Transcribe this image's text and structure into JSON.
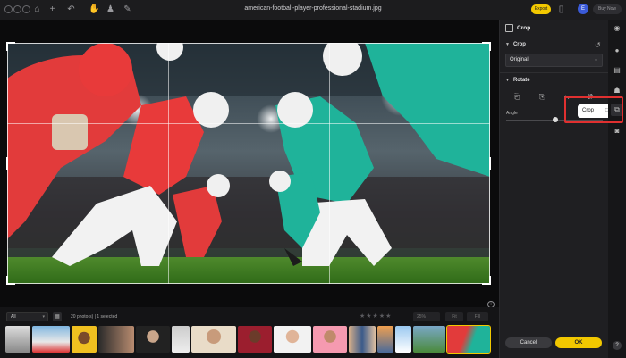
{
  "window": {
    "title": "american-football-player-professional-stadium.jpg"
  },
  "topbar": {
    "export_label": "Export",
    "user_initial": "E",
    "buy_label": "Buy Now"
  },
  "filmstrip": {
    "filter_value": "All",
    "photo_count": "20 photo(s) | 1 selected",
    "zoom_value": "25%",
    "fit_label": "Fit",
    "fill_label": "Fill"
  },
  "panel": {
    "header": "Crop",
    "crop_section": "Crop",
    "ratio_value": "Original",
    "rotate_section": "Rotate",
    "angle_label": "Angle",
    "cancel_label": "Cancel",
    "ok_label": "OK",
    "angle_value": 0
  },
  "tooltip": {
    "label": "Crop",
    "shortcut": "C"
  },
  "colors": {
    "accent": "#f2c800",
    "highlight": "#e03030",
    "jersey_red": "#e83a3a",
    "jersey_teal": "#1fb39a"
  }
}
